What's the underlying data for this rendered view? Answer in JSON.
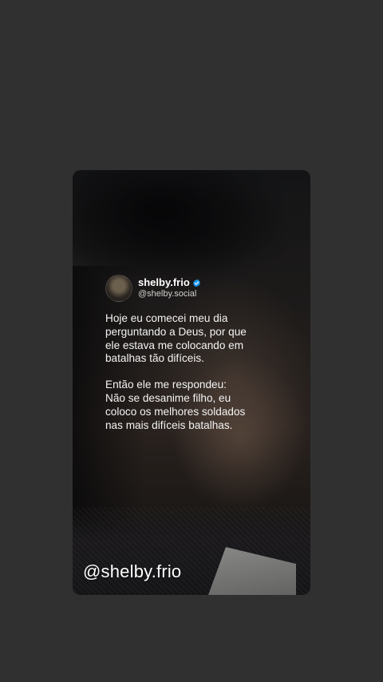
{
  "story": {
    "tweet": {
      "display_name": "shelby.frio",
      "handle": "@shelby.social",
      "verified_icon": "verified-badge-icon",
      "verified_color": "#1d9bf0",
      "avatar": "profile-avatar",
      "paragraphs": [
        [
          "Hoje eu comecei meu dia",
          "perguntando a Deus, por que",
          "ele estava me colocando em",
          "batalhas tão difíceis."
        ],
        [
          "Então ele me respondeu:",
          "Não se desanime filho, eu",
          "coloco os melhores soldados",
          "nas mais difíceis batalhas."
        ]
      ]
    },
    "watermark": "@shelby.frio"
  }
}
